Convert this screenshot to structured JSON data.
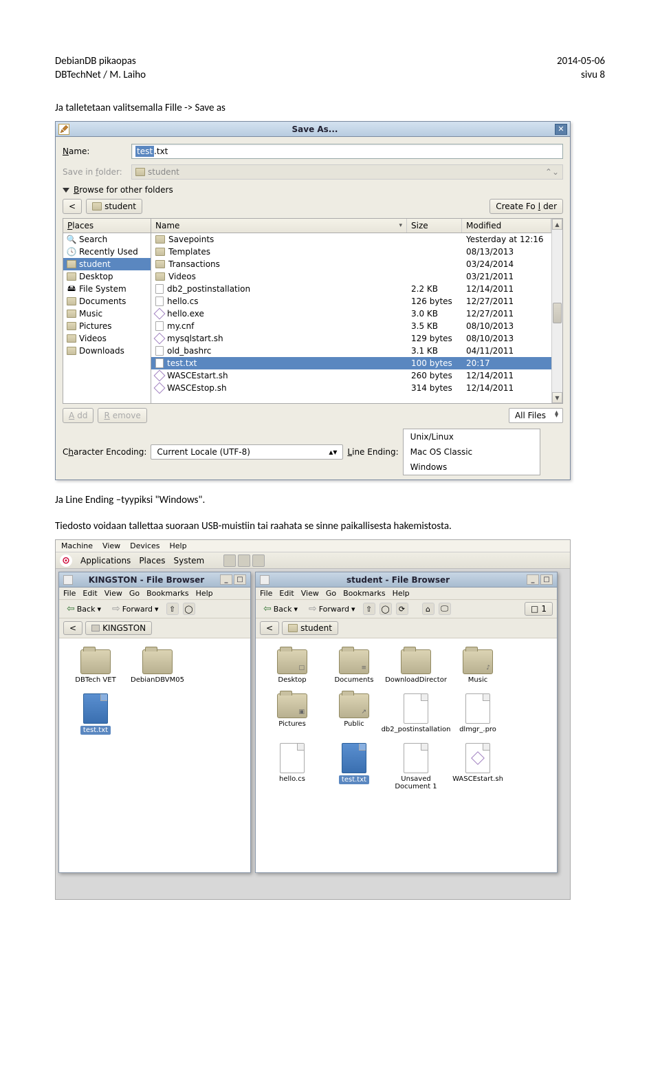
{
  "header": {
    "title": "DebianDB pikaopas",
    "subtitle": "DBTechNet / M. Laiho",
    "date": "2014-05-06",
    "page": "sivu 8"
  },
  "text": {
    "intro": "Ja talletetaan valitsemalla Fille -> Save as",
    "line_ending_note": "Ja Line Ending –tyypiksi \"Windows\".",
    "save_note": "Tiedosto voidaan tallettaa suoraan USB-muistiin tai raahata se sinne paikallisesta hakemistosta."
  },
  "save_dialog": {
    "title": "Save As...",
    "name_label": "Name:",
    "name_value_sel": "test",
    "name_value_ext": ".txt",
    "save_in_label": "Save in folder:",
    "save_in_value": "student",
    "browse_toggle": "Browse for other folders",
    "path_seg": "student",
    "create_folder": "Create Folder",
    "places_header": "Places",
    "places": [
      {
        "icon": "search",
        "label": "Search"
      },
      {
        "icon": "recent",
        "label": "Recently Used"
      },
      {
        "icon": "home",
        "label": "student",
        "selected": true
      },
      {
        "icon": "home",
        "label": "Desktop"
      },
      {
        "icon": "fs",
        "label": "File System"
      },
      {
        "icon": "folder",
        "label": "Documents"
      },
      {
        "icon": "folder",
        "label": "Music"
      },
      {
        "icon": "folder",
        "label": "Pictures"
      },
      {
        "icon": "folder",
        "label": "Videos"
      },
      {
        "icon": "folder",
        "label": "Downloads"
      }
    ],
    "cols": {
      "name": "Name",
      "size": "Size",
      "modified": "Modified"
    },
    "files": [
      {
        "icon": "folder",
        "name": "Savepoints",
        "size": "",
        "mod": "Yesterday at 12:16"
      },
      {
        "icon": "folder",
        "name": "Templates",
        "size": "",
        "mod": "08/13/2013"
      },
      {
        "icon": "folder",
        "name": "Transactions",
        "size": "",
        "mod": "03/24/2014"
      },
      {
        "icon": "folder",
        "name": "Videos",
        "size": "",
        "mod": "03/21/2011"
      },
      {
        "icon": "file",
        "name": "db2_postinstallation",
        "size": "2.2 KB",
        "mod": "12/14/2011"
      },
      {
        "icon": "file",
        "name": "hello.cs",
        "size": "126 bytes",
        "mod": "12/27/2011"
      },
      {
        "icon": "exe",
        "name": "hello.exe",
        "size": "3.0 KB",
        "mod": "12/27/2011"
      },
      {
        "icon": "file",
        "name": "my.cnf",
        "size": "3.5 KB",
        "mod": "08/10/2013"
      },
      {
        "icon": "exe",
        "name": "mysqlstart.sh",
        "size": "129 bytes",
        "mod": "08/10/2013"
      },
      {
        "icon": "file",
        "name": "old_bashrc",
        "size": "3.1 KB",
        "mod": "04/11/2011"
      },
      {
        "icon": "file",
        "name": "test.txt",
        "size": "100 bytes",
        "mod": "20:17",
        "selected": true
      },
      {
        "icon": "exe",
        "name": "WASCEstart.sh",
        "size": "260 bytes",
        "mod": "12/14/2011"
      },
      {
        "icon": "exe",
        "name": "WASCEstop.sh",
        "size": "314 bytes",
        "mod": "12/14/2011"
      }
    ],
    "add_btn": "Add",
    "remove_btn": "Remove",
    "filter": "All Files",
    "char_enc_label": "Character Encoding:",
    "char_enc_value": "Current Locale (UTF-8)",
    "line_ending_label": "Line Ending:",
    "line_ending_options": [
      "Unix/Linux",
      "Mac OS Classic",
      "Windows"
    ]
  },
  "browser": {
    "vm_menu": [
      "Machine",
      "View",
      "Devices",
      "Help"
    ],
    "panel": [
      "Applications",
      "Places",
      "System"
    ],
    "kingston": {
      "title": "KINGSTON - File Browser",
      "menu": [
        "File",
        "Edit",
        "View",
        "Go",
        "Bookmarks",
        "Help"
      ],
      "back": "Back",
      "forward": "Forward",
      "path": "KINGSTON",
      "items": [
        {
          "type": "folder",
          "label": "DBTech VET"
        },
        {
          "type": "folder",
          "label": "DebianDBVM05"
        },
        {
          "type": "bluefile",
          "label": "test.txt",
          "selected": true
        }
      ]
    },
    "student": {
      "title": "student - File Browser",
      "menu": [
        "File",
        "Edit",
        "View",
        "Go",
        "Bookmarks",
        "Help"
      ],
      "back": "Back",
      "forward": "Forward",
      "one": "1",
      "path": "student",
      "items": [
        {
          "type": "folder",
          "label": "Desktop",
          "badge": "□"
        },
        {
          "type": "folder",
          "label": "Documents",
          "badge": "≡"
        },
        {
          "type": "folder",
          "label": "DownloadDirector"
        },
        {
          "type": "folder",
          "label": "Music",
          "badge": "♪"
        },
        {
          "type": "folder",
          "label": "Pictures",
          "badge": "▣"
        },
        {
          "type": "folder",
          "label": "Public",
          "badge": "↗"
        },
        {
          "type": "file",
          "label": "db2_postinstallation"
        },
        {
          "type": "file",
          "label": "dlmgr_.pro"
        },
        {
          "type": "file",
          "label": "hello.cs"
        },
        {
          "type": "bluefile",
          "label": "test.txt",
          "selected": true
        },
        {
          "type": "file",
          "label": "Unsaved Document 1"
        },
        {
          "type": "exe",
          "label": "WASCEstart.sh"
        }
      ]
    }
  }
}
